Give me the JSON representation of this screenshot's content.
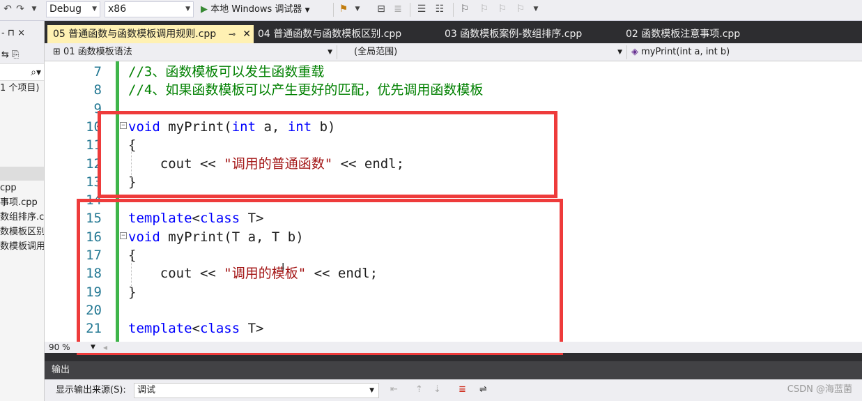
{
  "toolbar": {
    "config": "Debug",
    "platform": "x86",
    "run_label": "本地 Windows 调试器"
  },
  "left_panel": {
    "header": "- ⊓ ×",
    "items": [
      "1 个项目)",
      "cpp",
      "事项.cpp",
      "数组排序.c",
      "数模板区别",
      "数模板调用"
    ]
  },
  "tabs": [
    {
      "label": "05 普通函数与函数模板调用规则.cpp",
      "active": true
    },
    {
      "label": "04 普通函数与函数模板区别.cpp",
      "active": false
    },
    {
      "label": "03 函数模板案例-数组排序.cpp",
      "active": false
    },
    {
      "label": "02 函数模板注意事项.cpp",
      "active": false
    }
  ],
  "navbar": {
    "project": "01 函数模板语法",
    "scope": "(全局范围)",
    "member": "myPrint(int a, int b)"
  },
  "code": [
    {
      "num": "7",
      "segments": [
        {
          "t": "//3、函数模板可以发生函数重载",
          "c": "cmt"
        }
      ]
    },
    {
      "num": "8",
      "segments": [
        {
          "t": "//4、如果函数模板可以产生更好的匹配，优先调用函数模板",
          "c": "cmt"
        }
      ]
    },
    {
      "num": "9",
      "segments": []
    },
    {
      "num": "10",
      "fold": true,
      "segments": [
        {
          "t": "void",
          "c": "kw"
        },
        {
          "t": " myPrint(",
          "c": "fn"
        },
        {
          "t": "int",
          "c": "kw"
        },
        {
          "t": " a, ",
          "c": "fn"
        },
        {
          "t": "int",
          "c": "kw"
        },
        {
          "t": " b)",
          "c": "fn"
        }
      ]
    },
    {
      "num": "11",
      "segments": [
        {
          "t": "{",
          "c": "fn"
        }
      ]
    },
    {
      "num": "12",
      "segments": [
        {
          "t": "    cout << ",
          "c": "fn"
        },
        {
          "t": "\"调用的普通函数\"",
          "c": "str"
        },
        {
          "t": " << endl;",
          "c": "fn"
        }
      ]
    },
    {
      "num": "13",
      "segments": [
        {
          "t": "}",
          "c": "fn"
        }
      ]
    },
    {
      "num": "14",
      "segments": []
    },
    {
      "num": "15",
      "segments": [
        {
          "t": "template",
          "c": "kw"
        },
        {
          "t": "<",
          "c": "fn"
        },
        {
          "t": "class",
          "c": "kw"
        },
        {
          "t": " T>",
          "c": "fn"
        }
      ]
    },
    {
      "num": "16",
      "fold": true,
      "segments": [
        {
          "t": "void",
          "c": "kw"
        },
        {
          "t": " myPrint(T a, T b)",
          "c": "fn"
        }
      ]
    },
    {
      "num": "17",
      "segments": [
        {
          "t": "{",
          "c": "fn"
        }
      ]
    },
    {
      "num": "18",
      "segments": [
        {
          "t": "    cout << ",
          "c": "fn"
        },
        {
          "t": "\"调用的模板\"",
          "c": "str"
        },
        {
          "t": " << endl;",
          "c": "fn"
        }
      ]
    },
    {
      "num": "19",
      "segments": [
        {
          "t": "}",
          "c": "fn"
        }
      ]
    },
    {
      "num": "20",
      "segments": []
    },
    {
      "num": "21",
      "segments": [
        {
          "t": "template",
          "c": "kw"
        },
        {
          "t": "<",
          "c": "fn"
        },
        {
          "t": "class",
          "c": "kw"
        },
        {
          "t": " T>",
          "c": "fn"
        }
      ]
    }
  ],
  "zoom": "90 %",
  "output": {
    "title": "输出",
    "source_label": "显示输出来源(S):",
    "source_value": "调试",
    "watermark": "CSDN @海蓝菌"
  },
  "colors": {
    "keyword": "#0000ff",
    "string": "#a31515",
    "comment": "#008000",
    "annotation": "#ee3b3b",
    "change_bar": "#3fb54a"
  }
}
